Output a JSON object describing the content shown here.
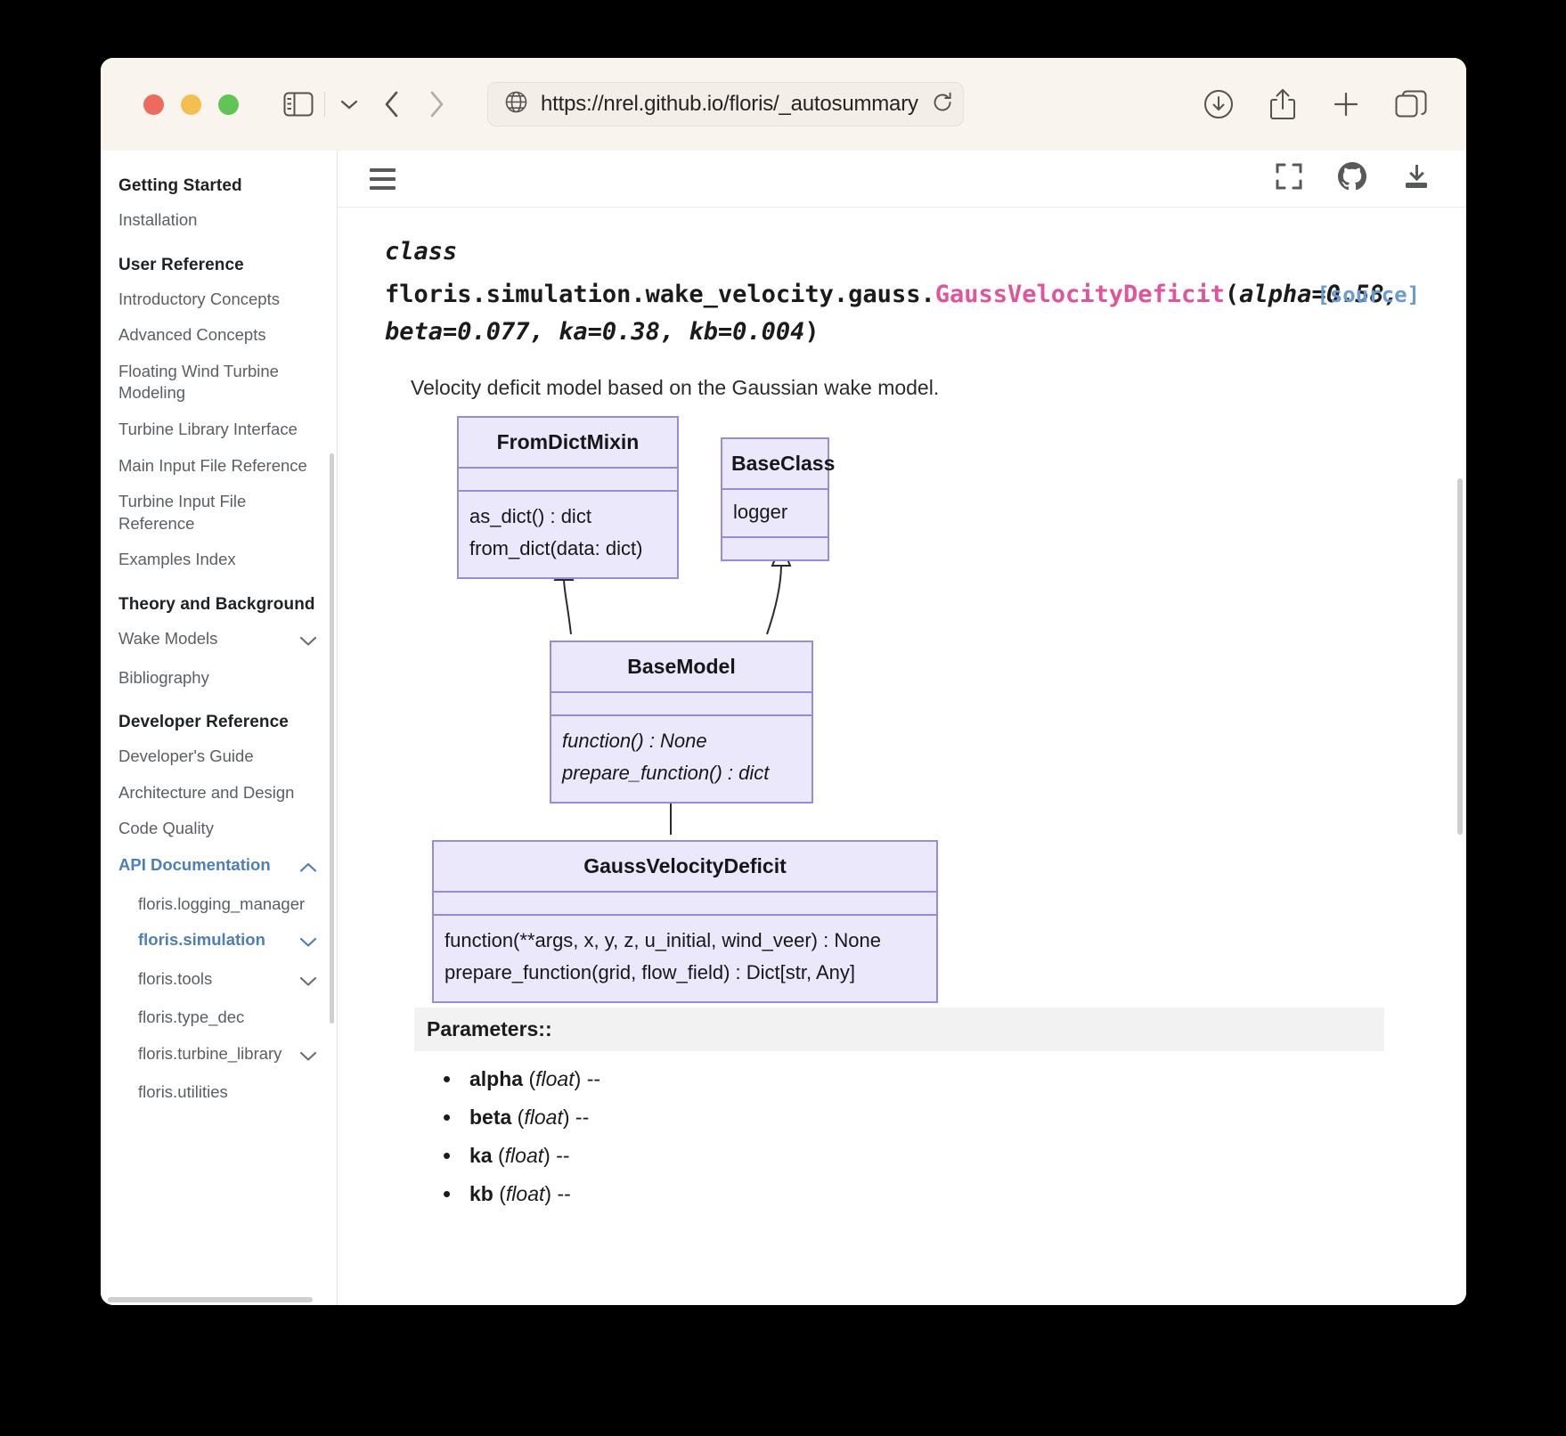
{
  "browser": {
    "url": "https://nrel.github.io/floris/_autosummary",
    "icons": {
      "globe": "globe-icon",
      "reload": "reload-icon",
      "sidebar_toggle": "sidebar-toggle-icon",
      "chevron_down": "chevron-down-icon",
      "back": "back-arrow-icon",
      "forward": "forward-arrow-icon",
      "downloads": "downloads-icon",
      "share": "share-icon",
      "new_tab": "plus-icon",
      "tabs": "tab-overview-icon"
    },
    "traffic_lights": {
      "close": "#ed6b5e",
      "minimize": "#f3bf4f",
      "zoom": "#61c555"
    }
  },
  "sidebar": {
    "sections": [
      {
        "caption": "Getting Started",
        "items": [
          {
            "label": "Installation",
            "active": false,
            "expandable": false,
            "nested": false
          }
        ]
      },
      {
        "caption": "User Reference",
        "items": [
          {
            "label": "Introductory Concepts",
            "active": false,
            "expandable": false,
            "nested": false
          },
          {
            "label": "Advanced Concepts",
            "active": false,
            "expandable": false,
            "nested": false
          },
          {
            "label": "Floating Wind Turbine Modeling",
            "active": false,
            "expandable": false,
            "nested": false
          },
          {
            "label": "Turbine Library Interface",
            "active": false,
            "expandable": false,
            "nested": false
          },
          {
            "label": "Main Input File Reference",
            "active": false,
            "expandable": false,
            "nested": false
          },
          {
            "label": "Turbine Input File Reference",
            "active": false,
            "expandable": false,
            "nested": false
          },
          {
            "label": "Examples Index",
            "active": false,
            "expandable": false,
            "nested": false
          }
        ]
      },
      {
        "caption": "Theory and Background",
        "items": [
          {
            "label": "Wake Models",
            "active": false,
            "expandable": true,
            "expanded": false,
            "nested": false
          },
          {
            "label": "Bibliography",
            "active": false,
            "expandable": false,
            "nested": false
          }
        ]
      },
      {
        "caption": "Developer Reference",
        "items": [
          {
            "label": "Developer's Guide",
            "active": false,
            "expandable": false,
            "nested": false
          },
          {
            "label": "Architecture and Design",
            "active": false,
            "expandable": false,
            "nested": false
          },
          {
            "label": "Code Quality",
            "active": false,
            "expandable": false,
            "nested": false
          },
          {
            "label": "API Documentation",
            "active": true,
            "expandable": true,
            "expanded": true,
            "nested": false
          },
          {
            "label": "floris.logging_manager",
            "active": false,
            "expandable": false,
            "nested": true
          },
          {
            "label": "floris.simulation",
            "active": true,
            "expandable": true,
            "expanded": false,
            "nested": true
          },
          {
            "label": "floris.tools",
            "active": false,
            "expandable": true,
            "expanded": false,
            "nested": true
          },
          {
            "label": "floris.type_dec",
            "active": false,
            "expandable": false,
            "nested": true
          },
          {
            "label": "floris.turbine_library",
            "active": false,
            "expandable": true,
            "expanded": false,
            "nested": true
          },
          {
            "label": "floris.utilities",
            "active": false,
            "expandable": false,
            "nested": true
          }
        ]
      }
    ]
  },
  "content_toolbar": {
    "menu": "hamburger-menu-icon",
    "fullscreen": "fullscreen-icon",
    "github": "github-icon",
    "download": "download-icon"
  },
  "doc": {
    "class_keyword": "class",
    "qualified_path": "floris.simulation.wake_velocity.gauss.",
    "class_name": "GaussVelocityDeficit",
    "signature_open": "(",
    "signature_args_line1": "alpha=0.58,",
    "signature_args_line2": "beta=0.077, ka=0.38, kb=0.004",
    "signature_close": ")",
    "source_label": "[source]",
    "description": "Velocity deficit model based on the Gaussian wake model.",
    "accent_class_color": "#e0559a",
    "link_color": "#6b9bd0"
  },
  "uml": {
    "box_border": "#9b8ad6",
    "box_fill": "#ebe8fb",
    "classes": [
      {
        "name": "FromDictMixin",
        "attributes": [],
        "methods": [
          "as_dict() : dict",
          "from_dict(data: dict)"
        ],
        "abstract": false
      },
      {
        "name": "BaseClass",
        "attributes": [
          "logger"
        ],
        "methods": [],
        "abstract": false
      },
      {
        "name": "BaseModel",
        "attributes": [],
        "methods": [
          "function() : None",
          "prepare_function() : dict"
        ],
        "abstract": true
      },
      {
        "name": "GaussVelocityDeficit",
        "attributes": [],
        "methods": [
          "function(**args, x, y, z, u_initial, wind_veer) : None",
          "prepare_function(grid, flow_field) : Dict[str, Any]"
        ],
        "abstract": false
      }
    ],
    "inheritance": [
      {
        "child": "BaseModel",
        "parent": "FromDictMixin"
      },
      {
        "child": "BaseModel",
        "parent": "BaseClass"
      },
      {
        "child": "GaussVelocityDeficit",
        "parent": "BaseModel"
      }
    ]
  },
  "parameters": {
    "heading": "Parameters::",
    "items": [
      {
        "name": "alpha",
        "type": "float",
        "dash": "--"
      },
      {
        "name": "beta",
        "type": "float",
        "dash": "--"
      },
      {
        "name": "ka",
        "type": "float",
        "dash": "--"
      },
      {
        "name": "kb",
        "type": "float",
        "dash": "--"
      }
    ]
  }
}
